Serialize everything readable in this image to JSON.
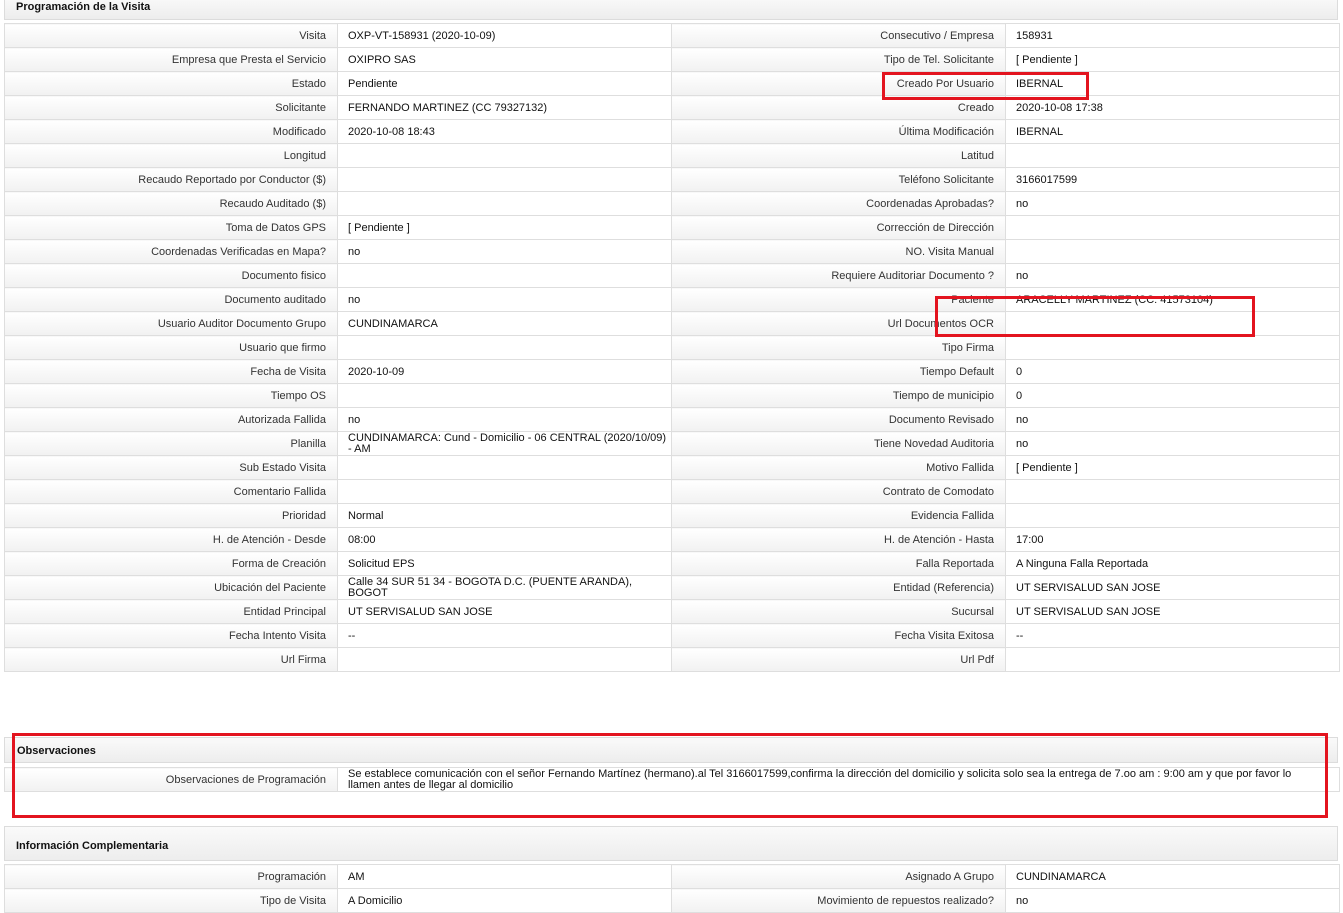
{
  "programacion": {
    "title": "Programación de la Visita",
    "rows": [
      {
        "l1": "Visita",
        "v1": "OXP-VT-158931 (2020-10-09)",
        "l2": "Consecutivo / Empresa",
        "v2": "158931"
      },
      {
        "l1": "Empresa que Presta el Servicio",
        "v1": "OXIPRO SAS",
        "l2": "Tipo de Tel. Solicitante",
        "v2": "[ Pendiente ]"
      },
      {
        "l1": "Estado",
        "v1": "Pendiente",
        "l2": "Creado Por Usuario",
        "v2": "IBERNAL"
      },
      {
        "l1": "Solicitante",
        "v1": "FERNANDO MARTINEZ (CC 79327132)",
        "l2": "Creado",
        "v2": "2020-10-08 17:38"
      },
      {
        "l1": "Modificado",
        "v1": "2020-10-08 18:43",
        "l2": "Última Modificación",
        "v2": " IBERNAL"
      },
      {
        "l1": "Longitud",
        "v1": "",
        "l2": "Latitud",
        "v2": ""
      },
      {
        "l1": "Recaudo Reportado por Conductor ($)",
        "v1": "",
        "l2": "Teléfono Solicitante",
        "v2": "3166017599"
      },
      {
        "l1": "Recaudo Auditado ($)",
        "v1": "",
        "l2": "Coordenadas Aprobadas?",
        "v2": " no"
      },
      {
        "l1": "Toma de Datos GPS",
        "v1": "[ Pendiente ]",
        "l2": "Corrección de Dirección",
        "v2": ""
      },
      {
        "l1": "Coordenadas Verificadas en Mapa?",
        "v1": " no",
        "l2": "NO. Visita Manual",
        "v2": ""
      },
      {
        "l1": "Documento fisico",
        "v1": "",
        "l2": "Requiere Auditoriar Documento ?",
        "v2": " no"
      },
      {
        "l1": "Documento auditado",
        "v1": " no",
        "l2": "Paciente",
        "v2": "ARACELLY MARTINEZ (CC: 41573104)"
      },
      {
        "l1": "Usuario Auditor Documento Grupo",
        "v1": "CUNDINAMARCA",
        "l2": "Url Documentos OCR",
        "v2": ""
      },
      {
        "l1": "Usuario que firmo",
        "v1": "",
        "l2": "Tipo Firma",
        "v2": ""
      },
      {
        "l1": "Fecha de Visita",
        "v1": " 2020-10-09",
        "l2": "Tiempo Default",
        "v2": "0"
      },
      {
        "l1": "Tiempo OS",
        "v1": "",
        "l2": "Tiempo de municipio",
        "v2": "0"
      },
      {
        "l1": "Autorizada Fallida",
        "v1": " no",
        "l2": "Documento Revisado",
        "v2": " no"
      },
      {
        "l1": "Planilla",
        "v1": "CUNDINAMARCA: Cund - Domicilio - 06 CENTRAL (2020/10/09) - AM",
        "l2": "Tiene Novedad Auditoria",
        "v2": " no"
      },
      {
        "l1": "Sub Estado Visita",
        "v1": "",
        "l2": "Motivo Fallida",
        "v2": "[ Pendiente ]"
      },
      {
        "l1": "Comentario Fallida",
        "v1": "",
        "l2": "Contrato de Comodato",
        "v2": ""
      },
      {
        "l1": "Prioridad",
        "v1": "Normal",
        "l2": "Evidencia Fallida",
        "v2": ""
      },
      {
        "l1": "H. de Atención - Desde",
        "v1": "08:00",
        "l2": "H. de Atención - Hasta",
        "v2": "17:00"
      },
      {
        "l1": "Forma de Creación",
        "v1": "Solicitud EPS",
        "l2": "Falla Reportada",
        "v2": "A Ninguna Falla Reportada"
      },
      {
        "l1": "Ubicación del Paciente",
        "v1": "Calle 34 SUR 51 34 - BOGOTA D.C. (PUENTE ARANDA), BOGOT",
        "l2": "Entidad (Referencia)",
        "v2": "UT SERVISALUD SAN JOSE"
      },
      {
        "l1": "Entidad Principal",
        "v1": "UT SERVISALUD SAN JOSE",
        "l2": "Sucursal",
        "v2": "UT SERVISALUD SAN JOSE"
      },
      {
        "l1": "Fecha Intento Visita",
        "v1": " --",
        "l2": "Fecha Visita Exitosa",
        "v2": " --"
      },
      {
        "l1": "Url Firma",
        "v1": "",
        "l2": "Url Pdf",
        "v2": ""
      }
    ]
  },
  "observaciones": {
    "title": "Observaciones",
    "label": "Observaciones de Programación",
    "value": "  Se establece comunicación con el señor Fernando Martínez (hermano).al Tel 3166017599,confirma la dirección del domicilio y solicita solo sea la entrega de 7.oo am : 9:00 am y que por favor lo llamen antes de llegar al domicilio"
  },
  "complementaria": {
    "title": "Información Complementaria",
    "rows": [
      {
        "l1": "Programación",
        "v1": "AM",
        "l2": "Asignado A Grupo",
        "v2": "CUNDINAMARCA"
      },
      {
        "l1": "Tipo de Visita",
        "v1": "A Domicilio",
        "l2": "Movimiento de repuestos realizado?",
        "v2": " no"
      }
    ]
  },
  "highlight_color": "#e3141f"
}
